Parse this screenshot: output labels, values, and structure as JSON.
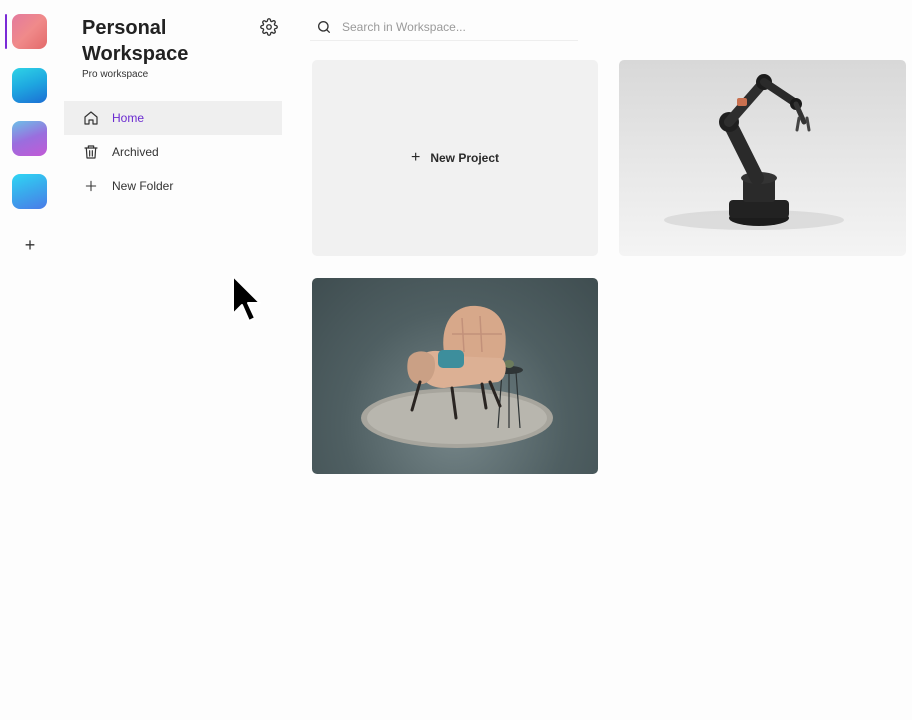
{
  "workspace": {
    "title": "Personal Workspace",
    "subtitle": "Pro workspace"
  },
  "rail": {
    "items": [
      {
        "icon": "workspace-avatar-red-icon",
        "colors": [
          "#f08a8a",
          "#c95b94"
        ]
      },
      {
        "icon": "workspace-avatar-teal-icon",
        "colors": [
          "#22c7e0",
          "#1a79d6"
        ]
      },
      {
        "icon": "workspace-avatar-purple-icon",
        "colors": [
          "#7cc1e8",
          "#b05ed8"
        ]
      },
      {
        "icon": "workspace-avatar-blue-icon",
        "colors": [
          "#2bd1f2",
          "#3b7fe6"
        ]
      }
    ],
    "add_label": "+"
  },
  "nav": {
    "items": [
      {
        "label": "Home",
        "icon": "home-icon"
      },
      {
        "label": "Archived",
        "icon": "trash-icon"
      },
      {
        "label": "New Folder",
        "icon": "plus-icon"
      }
    ]
  },
  "search": {
    "placeholder": "Search in Workspace..."
  },
  "projects": {
    "new_project_label": "New Project",
    "items": [
      {
        "thumbnail": "robot-arm"
      },
      {
        "thumbnail": "armchair"
      }
    ]
  },
  "colors": {
    "accent": "#6b2bd0",
    "active_bg": "#efefef",
    "card_bg": "#f1f1f1"
  }
}
